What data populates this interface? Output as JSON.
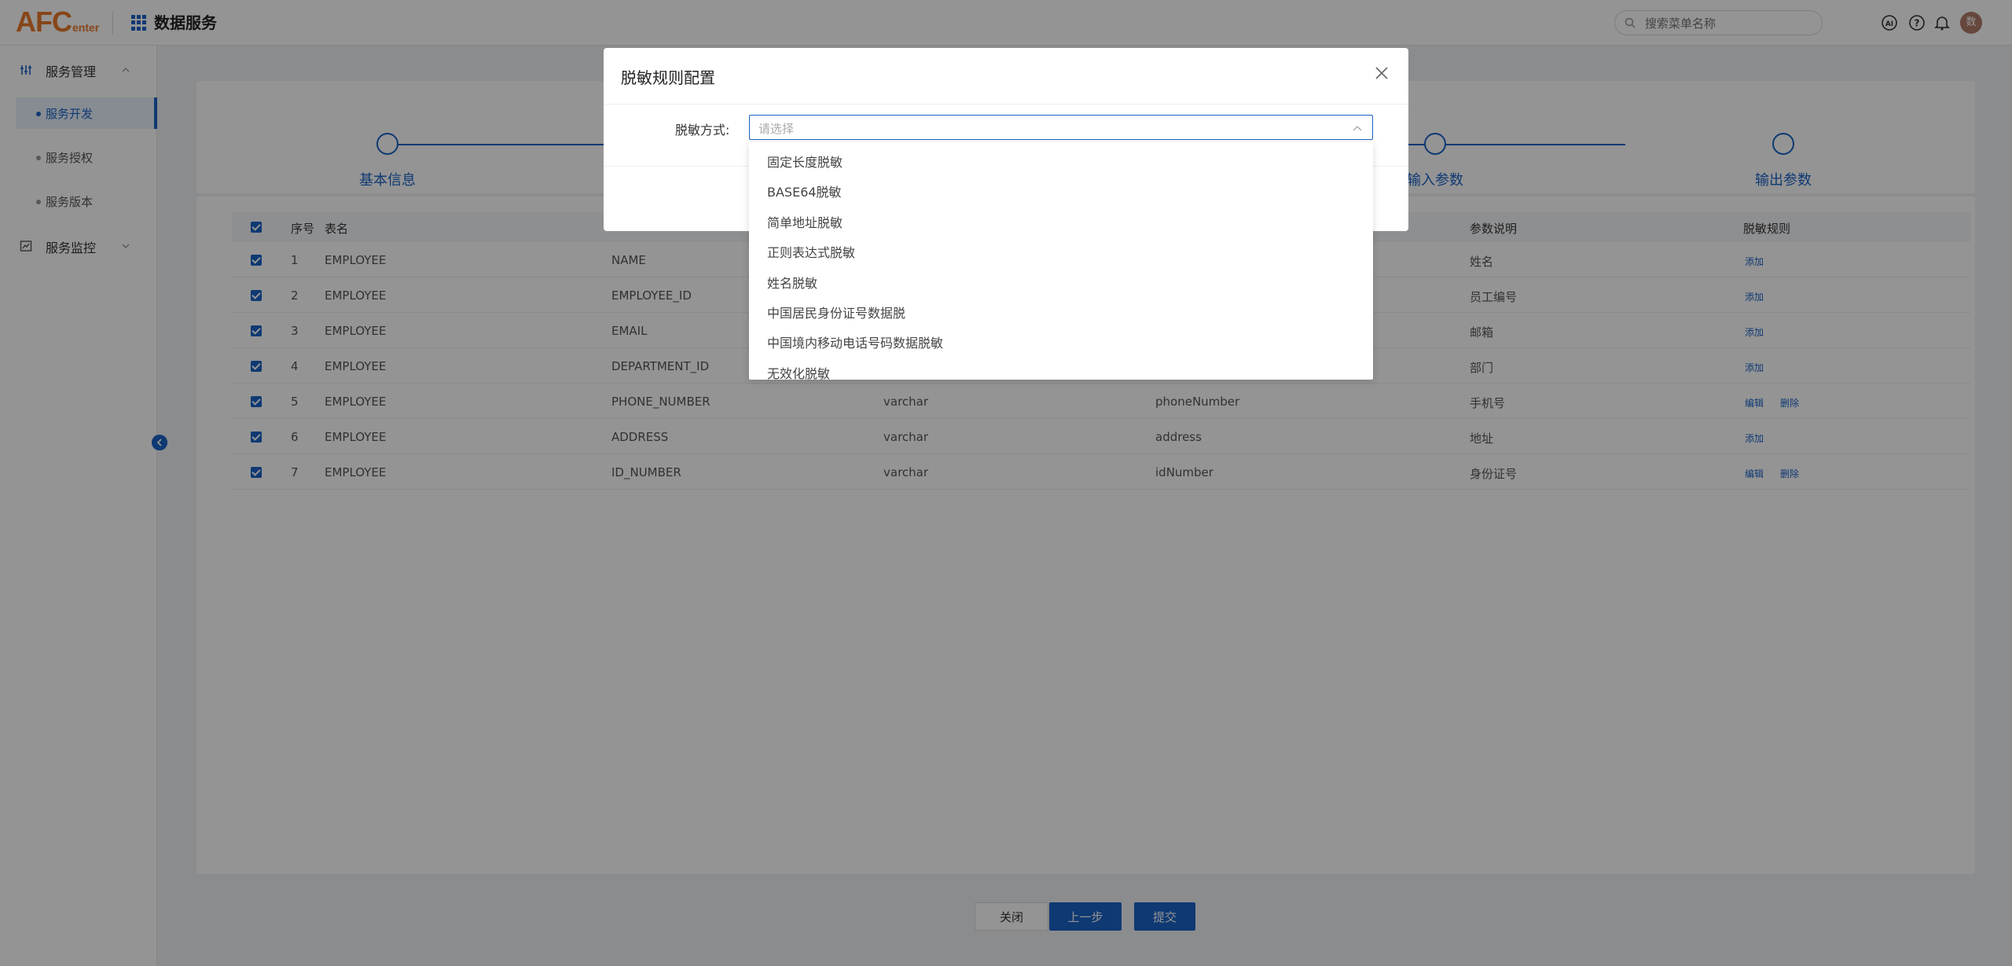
{
  "header": {
    "logo_text": "AFC",
    "logo_sub": "enter",
    "app_title": "数据服务",
    "search_placeholder": "搜索菜单名称",
    "avatar_text": "数"
  },
  "sidebar": {
    "groups": [
      {
        "label": "服务管理",
        "icon": "service-manage-icon"
      },
      {
        "label": "服务监控",
        "icon": "monitor-icon"
      }
    ],
    "items": [
      {
        "label": "服务开发",
        "active": true
      },
      {
        "label": "服务授权",
        "active": false
      },
      {
        "label": "服务版本",
        "active": false
      }
    ]
  },
  "steps": [
    {
      "label": "基本信息"
    },
    {
      "label": "输入参数"
    },
    {
      "label": "输出参数"
    }
  ],
  "table": {
    "headers": [
      "序号",
      "表名",
      "参数说明",
      "脱敏规则"
    ],
    "rows": [
      {
        "no": "1",
        "table": "EMPLOYEE",
        "field": "NAME",
        "type": "",
        "param": "",
        "desc": "姓名",
        "actions": [
          "添加"
        ]
      },
      {
        "no": "2",
        "table": "EMPLOYEE",
        "field": "EMPLOYEE_ID",
        "type": "",
        "param": "",
        "desc": "员工编号",
        "actions": [
          "添加"
        ]
      },
      {
        "no": "3",
        "table": "EMPLOYEE",
        "field": "EMAIL",
        "type": "",
        "param": "",
        "desc": "邮箱",
        "actions": [
          "添加"
        ]
      },
      {
        "no": "4",
        "table": "EMPLOYEE",
        "field": "DEPARTMENT_ID",
        "type": "",
        "param": "",
        "desc": "部门",
        "actions": [
          "添加"
        ]
      },
      {
        "no": "5",
        "table": "EMPLOYEE",
        "field": "PHONE_NUMBER",
        "type": "varchar",
        "param": "phoneNumber",
        "desc": "手机号",
        "actions": [
          "编辑",
          "删除"
        ]
      },
      {
        "no": "6",
        "table": "EMPLOYEE",
        "field": "ADDRESS",
        "type": "varchar",
        "param": "address",
        "desc": "地址",
        "actions": [
          "添加"
        ]
      },
      {
        "no": "7",
        "table": "EMPLOYEE",
        "field": "ID_NUMBER",
        "type": "varchar",
        "param": "idNumber",
        "desc": "身份证号",
        "actions": [
          "编辑",
          "删除"
        ]
      }
    ]
  },
  "footer": {
    "close_label": "关闭",
    "prev_label": "上一步",
    "submit_label": "提交"
  },
  "modal": {
    "title": "脱敏规则配置",
    "field_label": "脱敏方式:",
    "select_placeholder": "请选择",
    "options": [
      "固定长度脱敏",
      "BASE64脱敏",
      "简单地址脱敏",
      "正则表达式脱敏",
      "姓名脱敏",
      "中国居民身份证号数据脱",
      "中国境内移动电话号码数据脱敏",
      "无效化脱敏"
    ]
  },
  "colors": {
    "primary": "#1a62c7",
    "logo": "#e8792b"
  }
}
